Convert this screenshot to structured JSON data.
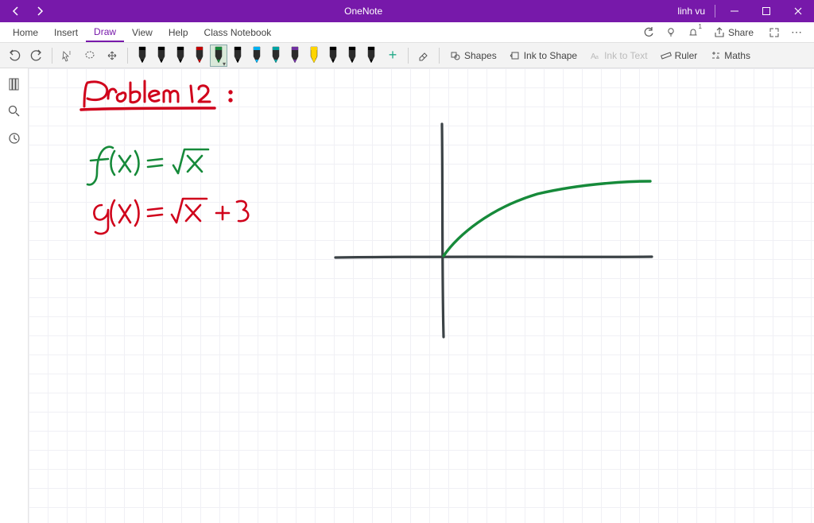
{
  "app": {
    "title": "OneNote",
    "user": "linh vu"
  },
  "menu": {
    "items": [
      "Home",
      "Insert",
      "Draw",
      "View",
      "Help",
      "Class Notebook"
    ],
    "active_index": 2,
    "share": "Share"
  },
  "toolbar": {
    "add": "+",
    "shapes": "Shapes",
    "ink_to_shape": "Ink to Shape",
    "ink_to_text": "Ink to Text",
    "ruler": "Ruler",
    "maths": "Maths",
    "pens": [
      {
        "color": "#000000",
        "type": "pen"
      },
      {
        "color": "#000000",
        "type": "pen"
      },
      {
        "color": "#000000",
        "type": "pen"
      },
      {
        "color": "#c00000",
        "type": "pen"
      },
      {
        "color": "#168a3a",
        "type": "pen",
        "selected": true
      },
      {
        "color": "#000000",
        "type": "pen"
      },
      {
        "color": "#00b0f0",
        "type": "pen"
      },
      {
        "color": "#00a2a2",
        "type": "pen"
      },
      {
        "color": "#7030a0",
        "type": "pen"
      },
      {
        "color": "#ffd500",
        "type": "hl"
      },
      {
        "color": "#000000",
        "type": "pen"
      },
      {
        "color": "#000000",
        "type": "pen"
      },
      {
        "color": "#000000",
        "type": "pen"
      }
    ]
  },
  "notes": {
    "title": "Problem 12",
    "eq1": "f(x) = √x",
    "eq2": "g(x) = √x + 3"
  },
  "colors": {
    "purple": "#7719AA",
    "red_ink": "#d0021b",
    "green_ink": "#168a3a",
    "axis_ink": "#3b4246"
  }
}
